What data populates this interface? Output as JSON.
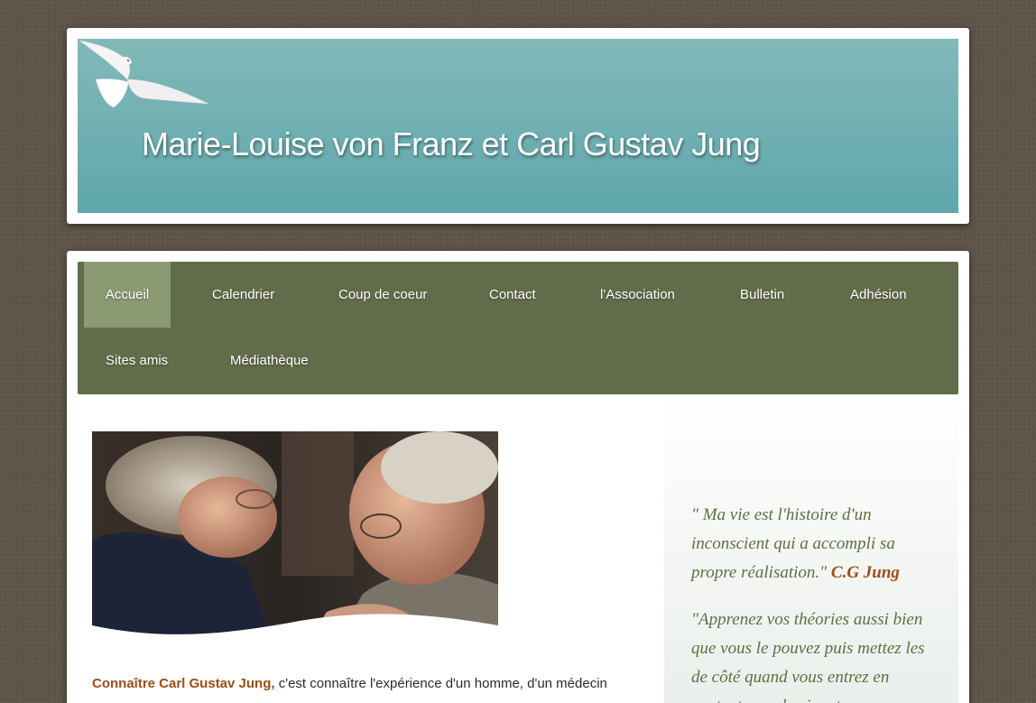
{
  "site": {
    "title": "Marie-Louise von Franz et Carl Gustav Jung"
  },
  "nav": {
    "items": [
      {
        "label": "Accueil",
        "active": true
      },
      {
        "label": "Calendrier"
      },
      {
        "label": "Coup de coeur"
      },
      {
        "label": "Contact"
      },
      {
        "label": "l'Association"
      },
      {
        "label": "Bulletin"
      },
      {
        "label": "Adhésion"
      },
      {
        "label": "Sites amis"
      },
      {
        "label": "Médiathèque"
      }
    ]
  },
  "main": {
    "intro_highlight": "Connaître Carl Gustav Jung,",
    "intro_text": " c'est connaître l'expérience d'un homme, d'un médecin"
  },
  "sidebar": {
    "quote1_text": "\" Ma vie est l'histoire d'un inconscient qui a accompli sa propre réalisation.\"",
    "quote1_author": "C.G Jung",
    "quote2_text": "\"Apprenez vos théories aussi bien que vous le pouvez puis mettez les de côté quand vous entrez en contact avec le vivant"
  },
  "colors": {
    "accent": "#9c4d15",
    "nav_bg": "#636c4a",
    "nav_active": "#8c9a72",
    "banner": "#6fb0b2",
    "quote": "#5f6e43"
  }
}
